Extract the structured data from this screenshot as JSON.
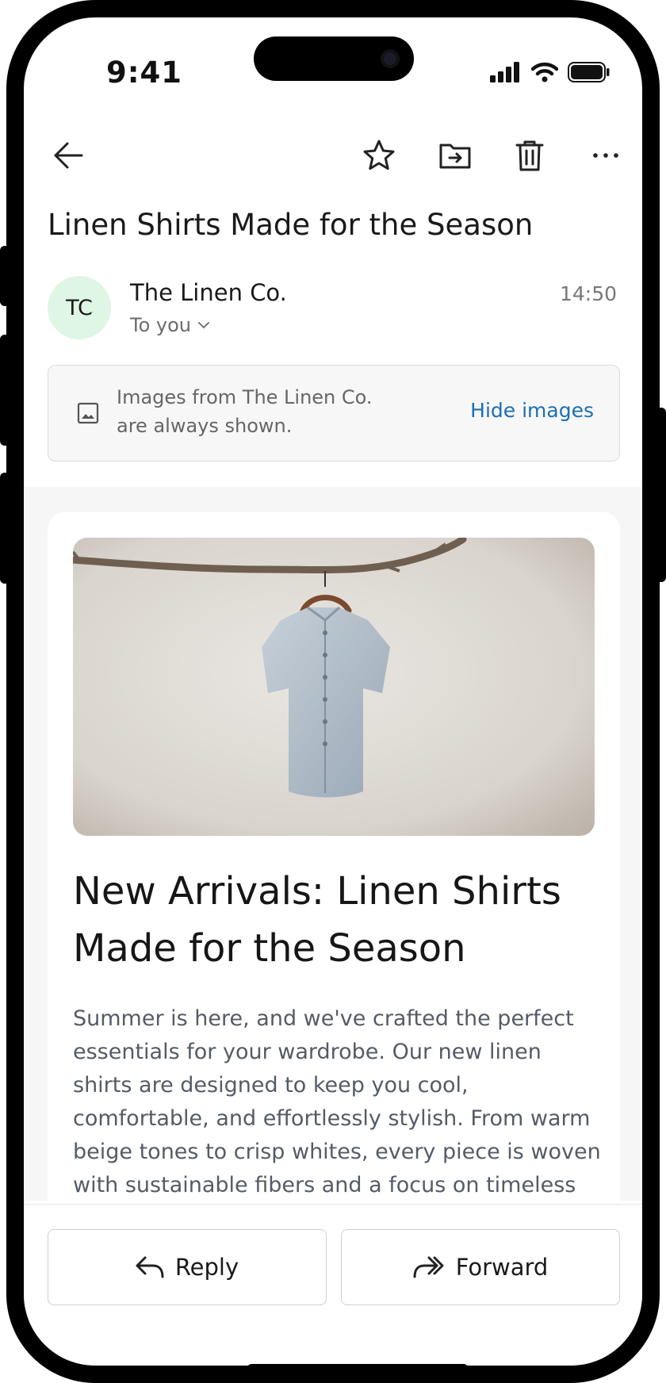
{
  "status": {
    "time": "9:41"
  },
  "toolbar": {
    "back": "back-arrow-icon",
    "star": "star-icon",
    "move": "move-to-folder-icon",
    "delete": "trash-icon",
    "more": "more-horizontal-icon"
  },
  "email": {
    "subject": "Linen Shirts Made for the Season",
    "avatar_initials": "TC",
    "avatar_color": "#def6e3",
    "sender": "The Linen Co.",
    "recipient": "To you",
    "time": "14:50"
  },
  "images_notice": {
    "text": "Images from The Linen Co. are always shown.",
    "action": "Hide images",
    "accent": "#1a6fb6"
  },
  "content": {
    "headline": "New Arrivals: Linen Shirts Made for the Season",
    "body": "Summer is here, and we've crafted the perfect essentials for your wardrobe. Our new linen shirts are designed to keep you cool, comfortable, and effortlessly stylish. From warm beige tones to crisp whites, every piece is woven with sustainable fibers and a focus on timeless design."
  },
  "actions": {
    "reply": "Reply",
    "forward": "Forward"
  }
}
